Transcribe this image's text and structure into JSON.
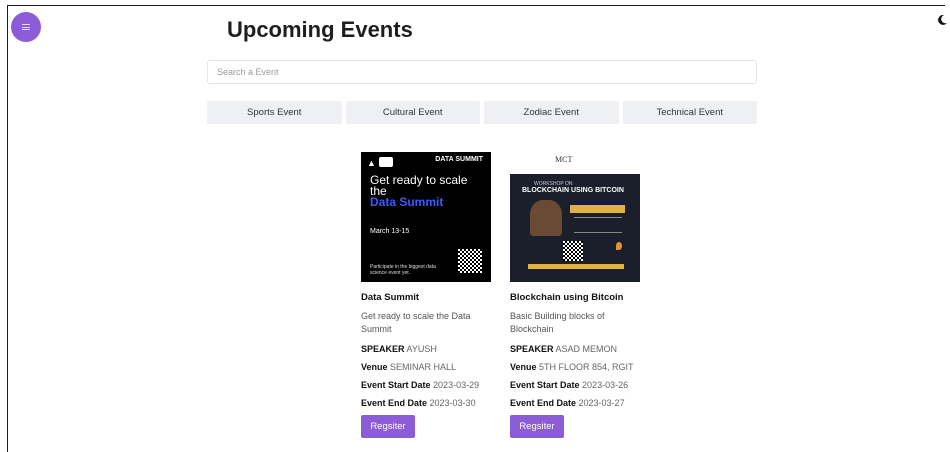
{
  "header": {
    "title": "Upcoming Events",
    "menu_icon": "menu-icon",
    "theme_icon": "moon-icon"
  },
  "search": {
    "placeholder": "Search a Event",
    "value": ""
  },
  "tabs": [
    {
      "label": "Sports Event"
    },
    {
      "label": "Cultural Event"
    },
    {
      "label": "Zodiac Event"
    },
    {
      "label": "Technical Event"
    }
  ],
  "colors": {
    "accent": "#8b5cd6",
    "tab_bg": "#eef0f4"
  },
  "labels": {
    "speaker": "SPEAKER",
    "venue": "Venue",
    "start": "Event Start Date",
    "end": "Event End Date",
    "register": "Regsiter"
  },
  "events": [
    {
      "name": "Data Summit",
      "description": "Get ready to scale the Data Summit",
      "speaker": "AYUSH",
      "venue": "SEMINAR HALL",
      "start_date": "2023-03-29",
      "end_date": "2023-03-30",
      "poster": {
        "brand": "DATA SUMMIT",
        "headline": "Get ready to scale the",
        "headline_accent": "Data Summit",
        "dates": "March 13-15",
        "footer": "Participate in the biggest data science event yet."
      }
    },
    {
      "name": "Blockchain using Bitcoin",
      "description": "Basic Building blocks of Blockchain",
      "speaker": "ASAD MEMON",
      "venue": "5TH FLOOR 854, RGIT",
      "start_date": "2023-03-26",
      "end_date": "2023-03-27",
      "poster": {
        "org": "MCT",
        "workshop": "WORKSHOP ON",
        "headline": "BLOCKCHAIN USING BITCOIN"
      }
    }
  ]
}
